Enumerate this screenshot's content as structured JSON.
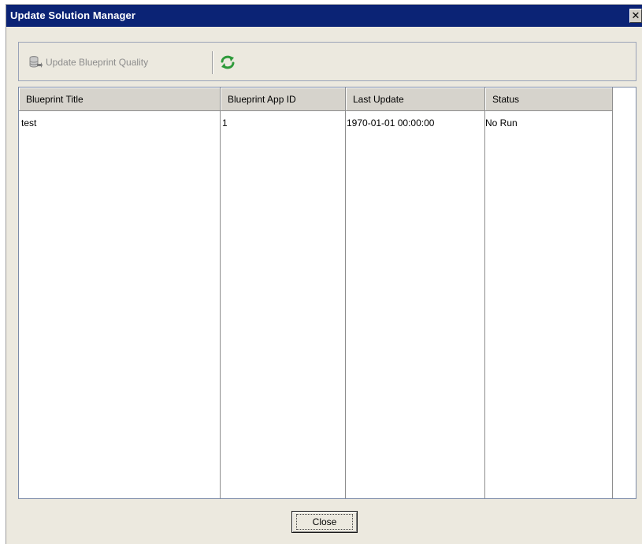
{
  "window": {
    "title": "Update Solution Manager",
    "close_glyph": "✕",
    "title_bar_color": "#0b2375",
    "background_color": "#ece9df"
  },
  "toolbar": {
    "update_quality_label": "Update Blueprint Quality",
    "update_quality_icon": "database-update-icon",
    "update_quality_enabled": false,
    "refresh_icon": "refresh-icon",
    "refresh_color": "#2e9a3a"
  },
  "table": {
    "columns": [
      "Blueprint Title",
      "Blueprint App ID",
      "Last Update",
      "Status"
    ],
    "rows": [
      [
        "test",
        "1",
        "1970-01-01 00:00:00",
        "No Run"
      ]
    ]
  },
  "footer": {
    "close_label": "Close"
  }
}
